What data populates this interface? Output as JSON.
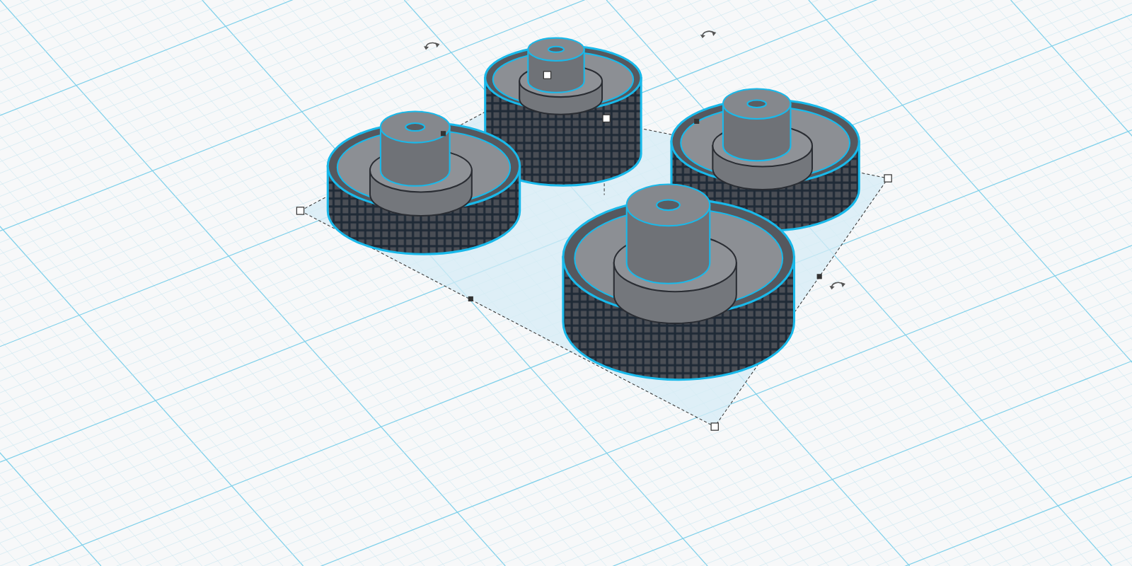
{
  "workplane": {
    "wheels": [
      {
        "selected": true
      },
      {
        "selected": true
      },
      {
        "selected": true
      },
      {
        "selected": true
      }
    ]
  }
}
